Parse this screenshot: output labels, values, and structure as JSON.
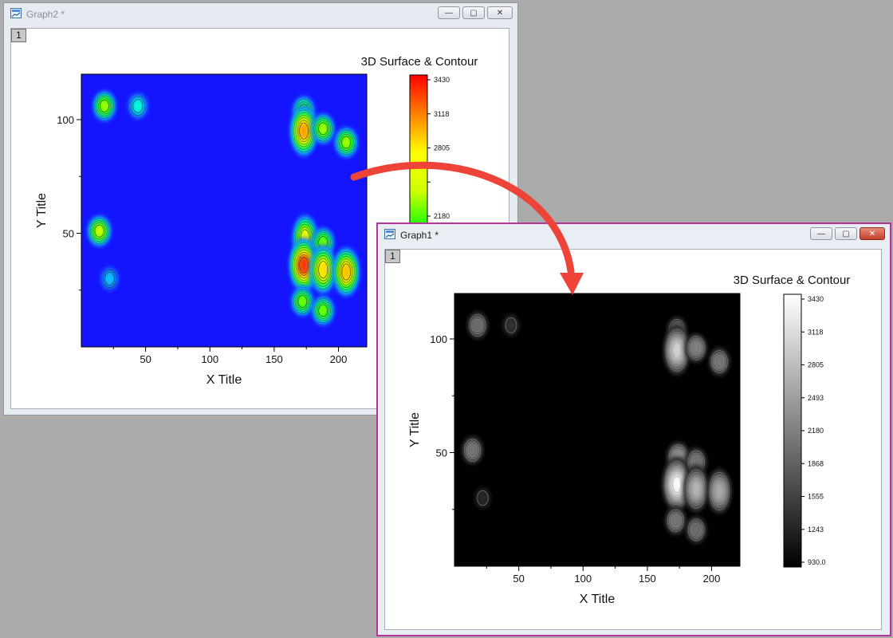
{
  "windows": {
    "graph2": {
      "title": "Graph2 *",
      "layer_label": "1"
    },
    "graph1": {
      "title": "Graph1 *",
      "layer_label": "1"
    }
  },
  "window_buttons": {
    "minimize_glyph": "—",
    "maximize_glyph": "▢",
    "close_glyph": "✕"
  },
  "chart_data": [
    {
      "type": "heatmap",
      "window": "Graph2",
      "title": "3D Surface & Contour",
      "xlabel": "X Title",
      "ylabel": "Y Title",
      "xlim": [
        0,
        222
      ],
      "ylim": [
        0,
        120
      ],
      "x_ticks": [
        50,
        100,
        150,
        200
      ],
      "y_ticks": [
        50,
        100
      ],
      "colormap": "rainbow",
      "colors": [
        "#1414ff",
        "#1e6bff",
        "#00ffff",
        "#00ff00",
        "#ccff00",
        "#ffff00",
        "#ff8000",
        "#ff0000"
      ],
      "colorbar_labels_visible": [
        "3430",
        "3118",
        "2805",
        "2180"
      ],
      "z_range": [
        930,
        3430
      ],
      "contour_lines": true,
      "hotspots": [
        {
          "x": 18,
          "y": 106,
          "z": 2300
        },
        {
          "x": 44,
          "y": 106,
          "z": 1700
        },
        {
          "x": 173,
          "y": 104,
          "z": 2100
        },
        {
          "x": 173,
          "y": 95,
          "z": 3000
        },
        {
          "x": 188,
          "y": 96,
          "z": 2300
        },
        {
          "x": 206,
          "y": 90,
          "z": 2300
        },
        {
          "x": 14,
          "y": 51,
          "z": 2400
        },
        {
          "x": 22,
          "y": 30,
          "z": 1500
        },
        {
          "x": 174,
          "y": 48,
          "z": 2600
        },
        {
          "x": 173,
          "y": 36,
          "z": 3300
        },
        {
          "x": 172,
          "y": 20,
          "z": 2200
        },
        {
          "x": 188,
          "y": 46,
          "z": 2200
        },
        {
          "x": 188,
          "y": 34,
          "z": 2800
        },
        {
          "x": 188,
          "y": 16,
          "z": 2200
        },
        {
          "x": 206,
          "y": 33,
          "z": 2900
        }
      ]
    },
    {
      "type": "heatmap",
      "window": "Graph1",
      "title": "3D Surface & Contour",
      "xlabel": "X Title",
      "ylabel": "Y Title",
      "xlim": [
        0,
        222
      ],
      "ylim": [
        0,
        120
      ],
      "x_ticks": [
        50,
        100,
        150,
        200
      ],
      "y_ticks": [
        50,
        100
      ],
      "colormap": "grayscale",
      "colors": [
        "#000000",
        "#ffffff"
      ],
      "colorbar_labels": [
        "3430",
        "3118",
        "2805",
        "2493",
        "2180",
        "1868",
        "1555",
        "1243",
        "930.0"
      ],
      "z_range": [
        930,
        3430
      ],
      "contour_lines": true,
      "hotspots": [
        {
          "x": 18,
          "y": 106,
          "z": 2000
        },
        {
          "x": 44,
          "y": 106,
          "z": 1400
        },
        {
          "x": 173,
          "y": 104,
          "z": 1900
        },
        {
          "x": 173,
          "y": 95,
          "z": 3000
        },
        {
          "x": 188,
          "y": 96,
          "z": 2200
        },
        {
          "x": 206,
          "y": 90,
          "z": 2100
        },
        {
          "x": 14,
          "y": 51,
          "z": 2100
        },
        {
          "x": 22,
          "y": 30,
          "z": 1300
        },
        {
          "x": 174,
          "y": 48,
          "z": 2400
        },
        {
          "x": 173,
          "y": 36,
          "z": 3400
        },
        {
          "x": 172,
          "y": 20,
          "z": 2100
        },
        {
          "x": 188,
          "y": 46,
          "z": 2100
        },
        {
          "x": 188,
          "y": 34,
          "z": 2700
        },
        {
          "x": 188,
          "y": 16,
          "z": 2000
        },
        {
          "x": 206,
          "y": 33,
          "z": 2600
        }
      ]
    }
  ]
}
